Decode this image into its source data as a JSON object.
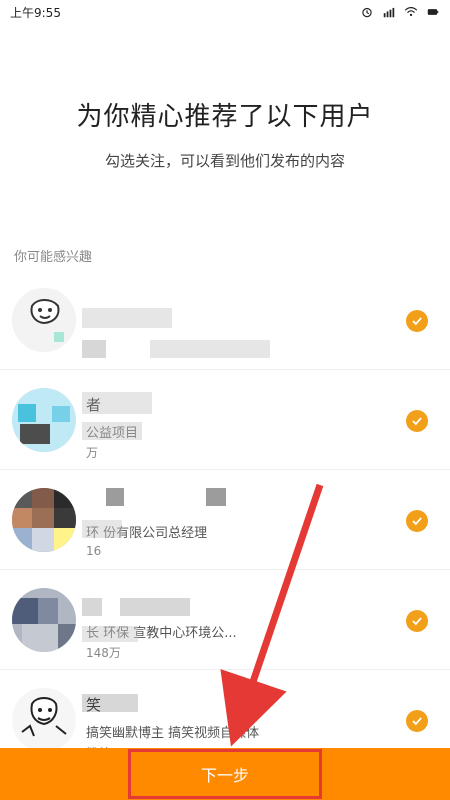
{
  "status": {
    "time": "上午9:55"
  },
  "header": {
    "title": "为你精心推荐了以下用户",
    "subtitle": "勾选关注，可以看到他们发布的内容"
  },
  "section": {
    "label": "你可能感兴趣"
  },
  "users": [
    {
      "name": "",
      "desc": "",
      "fans": ""
    },
    {
      "name": "者",
      "desc": "公益项目",
      "fans": "万"
    },
    {
      "name": "",
      "desc": "环 份有限公司总经理",
      "fans": "16"
    },
    {
      "name": "",
      "desc": "长 环保 宣教中心环境公...",
      "fans": "148万"
    },
    {
      "name": "笑",
      "desc": "搞笑幽默博主 搞笑视频自媒体",
      "fans": "粉丝"
    }
  ],
  "footer": {
    "next_label": "下一步"
  },
  "colors": {
    "accent": "#ff8a00",
    "check": "#f2a01a",
    "annotation": "#e53935"
  }
}
